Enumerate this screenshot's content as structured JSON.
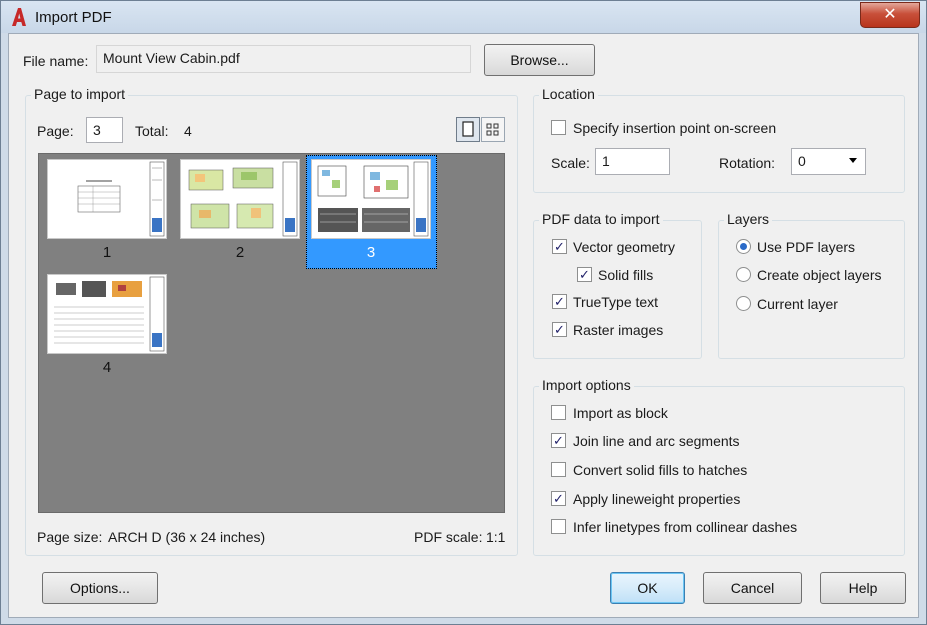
{
  "titlebar": {
    "title": "Import PDF",
    "close_label": "✕"
  },
  "file": {
    "label": "File name:",
    "value": "Mount View Cabin.pdf",
    "browse_label": "Browse..."
  },
  "page_to_import": {
    "group_label": "Page to import",
    "page_label": "Page:",
    "page_value": "3",
    "total_label": "Total:",
    "total_value": "4",
    "thumbnails": [
      {
        "number": "1",
        "selected": false
      },
      {
        "number": "2",
        "selected": false
      },
      {
        "number": "3",
        "selected": true
      },
      {
        "number": "4",
        "selected": false
      }
    ],
    "page_size_label": "Page size:",
    "page_size_value": "ARCH D (36 x 24 inches)",
    "pdf_scale_label": "PDF scale:",
    "pdf_scale_value": "1:1",
    "view_icons": [
      "single-page-view-icon",
      "grid-view-icon"
    ]
  },
  "location": {
    "group_label": "Location",
    "specify_label": "Specify insertion point on-screen",
    "specify_checked": false,
    "scale_label": "Scale:",
    "scale_value": "1",
    "rotation_label": "Rotation:",
    "rotation_value": "0"
  },
  "pdf_data": {
    "group_label": "PDF data to import",
    "items": [
      {
        "label": "Vector geometry",
        "checked": true
      },
      {
        "label": "Solid fills",
        "checked": true
      },
      {
        "label": "TrueType text",
        "checked": true
      },
      {
        "label": "Raster images",
        "checked": true
      }
    ]
  },
  "layers": {
    "group_label": "Layers",
    "options": [
      {
        "label": "Use PDF layers",
        "selected": true
      },
      {
        "label": "Create object layers",
        "selected": false
      },
      {
        "label": "Current layer",
        "selected": false
      }
    ]
  },
  "import_options": {
    "group_label": "Import options",
    "items": [
      {
        "label": "Import as block",
        "checked": false
      },
      {
        "label": "Join line and arc segments",
        "checked": true
      },
      {
        "label": "Convert solid fills to hatches",
        "checked": false
      },
      {
        "label": "Apply lineweight properties",
        "checked": true
      },
      {
        "label": "Infer linetypes from collinear dashes",
        "checked": false
      }
    ]
  },
  "buttons": {
    "options": "Options...",
    "ok": "OK",
    "cancel": "Cancel",
    "help": "Help"
  },
  "colors": {
    "selection": "#3399ff",
    "preview_bg": "#808080",
    "close_red": "#c8503a",
    "app_red": "#c62828"
  }
}
